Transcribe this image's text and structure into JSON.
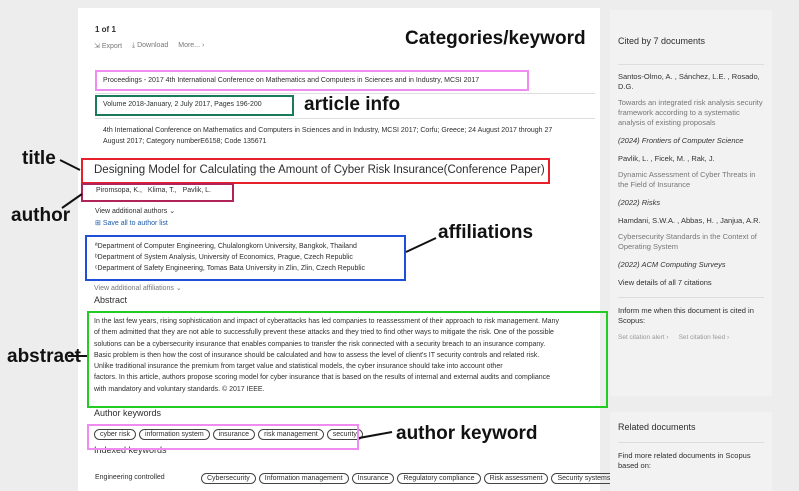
{
  "header": {
    "pagination": "1 of 1",
    "actions": [
      "Export",
      "Download",
      "More..."
    ]
  },
  "categories": "Proceedings - 2017 4th International Conference on Mathematics and Computers in Sciences and in Industry, MCSI 2017",
  "article_info": "Volume 2018-January, 2 July 2017, Pages 196-200",
  "conference_line1": "4th International Conference on Mathematics and Computers in Sciences and in Industry, MCSI 2017; Corfu; Greece; 24 August 2017 through 27",
  "conference_line2": "August 2017; Category numberE6158; Code 135671",
  "title": "Designing Model for Calculating the Amount of Cyber Risk Insurance(Conference Paper)",
  "authors": [
    "Piromsopa, K.,",
    "Klima, T.,",
    "Pavlik, L."
  ],
  "view_authors": "View additional authors",
  "save_authors": "Save all to author list",
  "affiliations": [
    "ªDepartment of Computer Engineering, Chulalongkorn University, Bangkok, Thailand",
    "ᵇDepartment of System Analysis, University of Economics, Prague, Czech Republic",
    "ᶜDepartment of Safety Engineering, Tomas Bata University in Zlin, Zlin, Czech Republic"
  ],
  "view_affiliations": "View additional affiliations",
  "abstract_heading": "Abstract",
  "abstract_lines": [
    "In the last few years, rising sophistication and impact of cyberattacks has led companies to reassessment of their approach to risk management. Many",
    "of them admitted that they are not able to successfully prevent these attacks and they tried to find other ways to mitigate the risk. One of the possible",
    "solutions can be a cybersecurity insurance that enables companies to transfer the risk connected with a security breach to an insurance company.",
    "Basic problem is then how the cost of insurance should be calculated and how to assess the level of client's IT security controls and related risk.",
    "Unlike traditional insurance the premium from target value and statistical models, the cyber insurance should take into account other",
    "factors. In this article, authors propose scoring model for cyber insurance that is based on the results of internal and external audits and compliance",
    "with mandatory and voluntary standards. © 2017 IEEE."
  ],
  "author_keywords_heading": "Author keywords",
  "author_keywords": [
    "cyber risk",
    "information system",
    "insurance",
    "risk management",
    "security"
  ],
  "indexed_keywords_heading": "Indexed keywords",
  "engineering_label": "Engineering controlled",
  "indexed_terms": [
    "Cybersecurity",
    "Information management",
    "Insurance",
    "Regulatory compliance",
    "Risk assessment",
    "Security systems"
  ],
  "annotations": {
    "categories": "Categories/keyword",
    "article_info": "article info",
    "title": "title",
    "author": "author",
    "affiliations": "affiliations",
    "abstract": "abstract",
    "author_keyword": "author keyword"
  },
  "annotation_colors": {
    "pink": "#f08cf0",
    "green": "#1a7a5a",
    "red": "#e8202a",
    "maroon": "#b0245a",
    "blue": "#1e4fd8",
    "lime": "#22cc22"
  },
  "sidebar": {
    "cited_by": "Cited by 7 documents",
    "docs": [
      {
        "authors": "Santos-Olmo, A. , Sánchez, L.E. , Rosado, D.G.",
        "title": "Towards an integrated risk analysis security framework according to a systematic analysis of existing proposals",
        "source": "(2024) Frontiers of Computer Science"
      },
      {
        "authors": "Pavlik, L. , Ficek, M. , Rak, J.",
        "title": "Dynamic Assessment of Cyber Threats in the Field of Insurance",
        "source": "(2022) Risks"
      },
      {
        "authors": "Hamdani, S.W.A. , Abbas, H. , Janjua, A.R.",
        "title": "Cybersecurity Standards in the Context of Operating System",
        "source": "(2022) ACM Computing Surveys"
      }
    ],
    "view_all": "View details of all 7 citations",
    "inform": "Inform me when this document is cited in Scopus:",
    "alert1": "Set citation alert ›",
    "alert2": "Set citation feed ›",
    "related": "Related documents",
    "find_more": "Find more related documents in Scopus based on:"
  }
}
